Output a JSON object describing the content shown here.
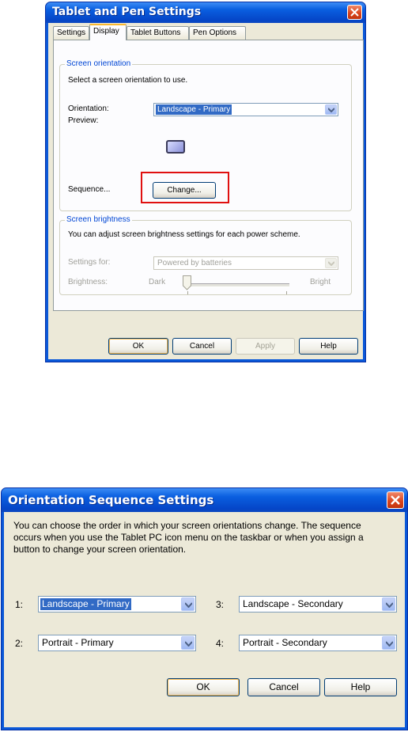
{
  "dialog1": {
    "title": "Tablet and Pen Settings",
    "tabs": [
      "Settings",
      "Display",
      "Tablet Buttons",
      "Pen Options"
    ],
    "active_tab": "Display",
    "orientation_group": {
      "label": "Screen orientation",
      "description": "Select a screen orientation to use.",
      "orientation_label": "Orientation:",
      "orientation_value": "Landscape - Primary",
      "preview_label": "Preview:",
      "sequence_label": "Sequence...",
      "change_button": "Change..."
    },
    "brightness_group": {
      "label": "Screen brightness",
      "description": "You can adjust screen brightness settings for each power scheme.",
      "settings_for_label": "Settings for:",
      "settings_for_value": "Powered by batteries",
      "brightness_label": "Brightness:",
      "dark_label": "Dark",
      "bright_label": "Bright"
    },
    "buttons": {
      "ok": "OK",
      "cancel": "Cancel",
      "apply": "Apply",
      "help": "Help"
    }
  },
  "dialog2": {
    "title": "Orientation Sequence Settings",
    "description": "You can choose the order in which your screen orientations change. The sequence occurs when you use the Tablet PC icon menu on the taskbar or when you assign a button to change your screen orientation.",
    "slots": [
      {
        "label": "1:",
        "value": "Landscape - Primary"
      },
      {
        "label": "2:",
        "value": "Portrait - Primary"
      },
      {
        "label": "3:",
        "value": "Landscape - Secondary"
      },
      {
        "label": "4:",
        "value": "Portrait - Secondary"
      }
    ],
    "buttons": {
      "ok": "OK",
      "cancel": "Cancel",
      "help": "Help"
    }
  },
  "colors": {
    "highlight_box": "#e01010",
    "group_label": "#0046d5",
    "titlebar": "#0a5fe0"
  },
  "icons": {
    "close": "close-icon",
    "dropdown": "chevron-down-icon",
    "preview": "monitor-icon"
  }
}
